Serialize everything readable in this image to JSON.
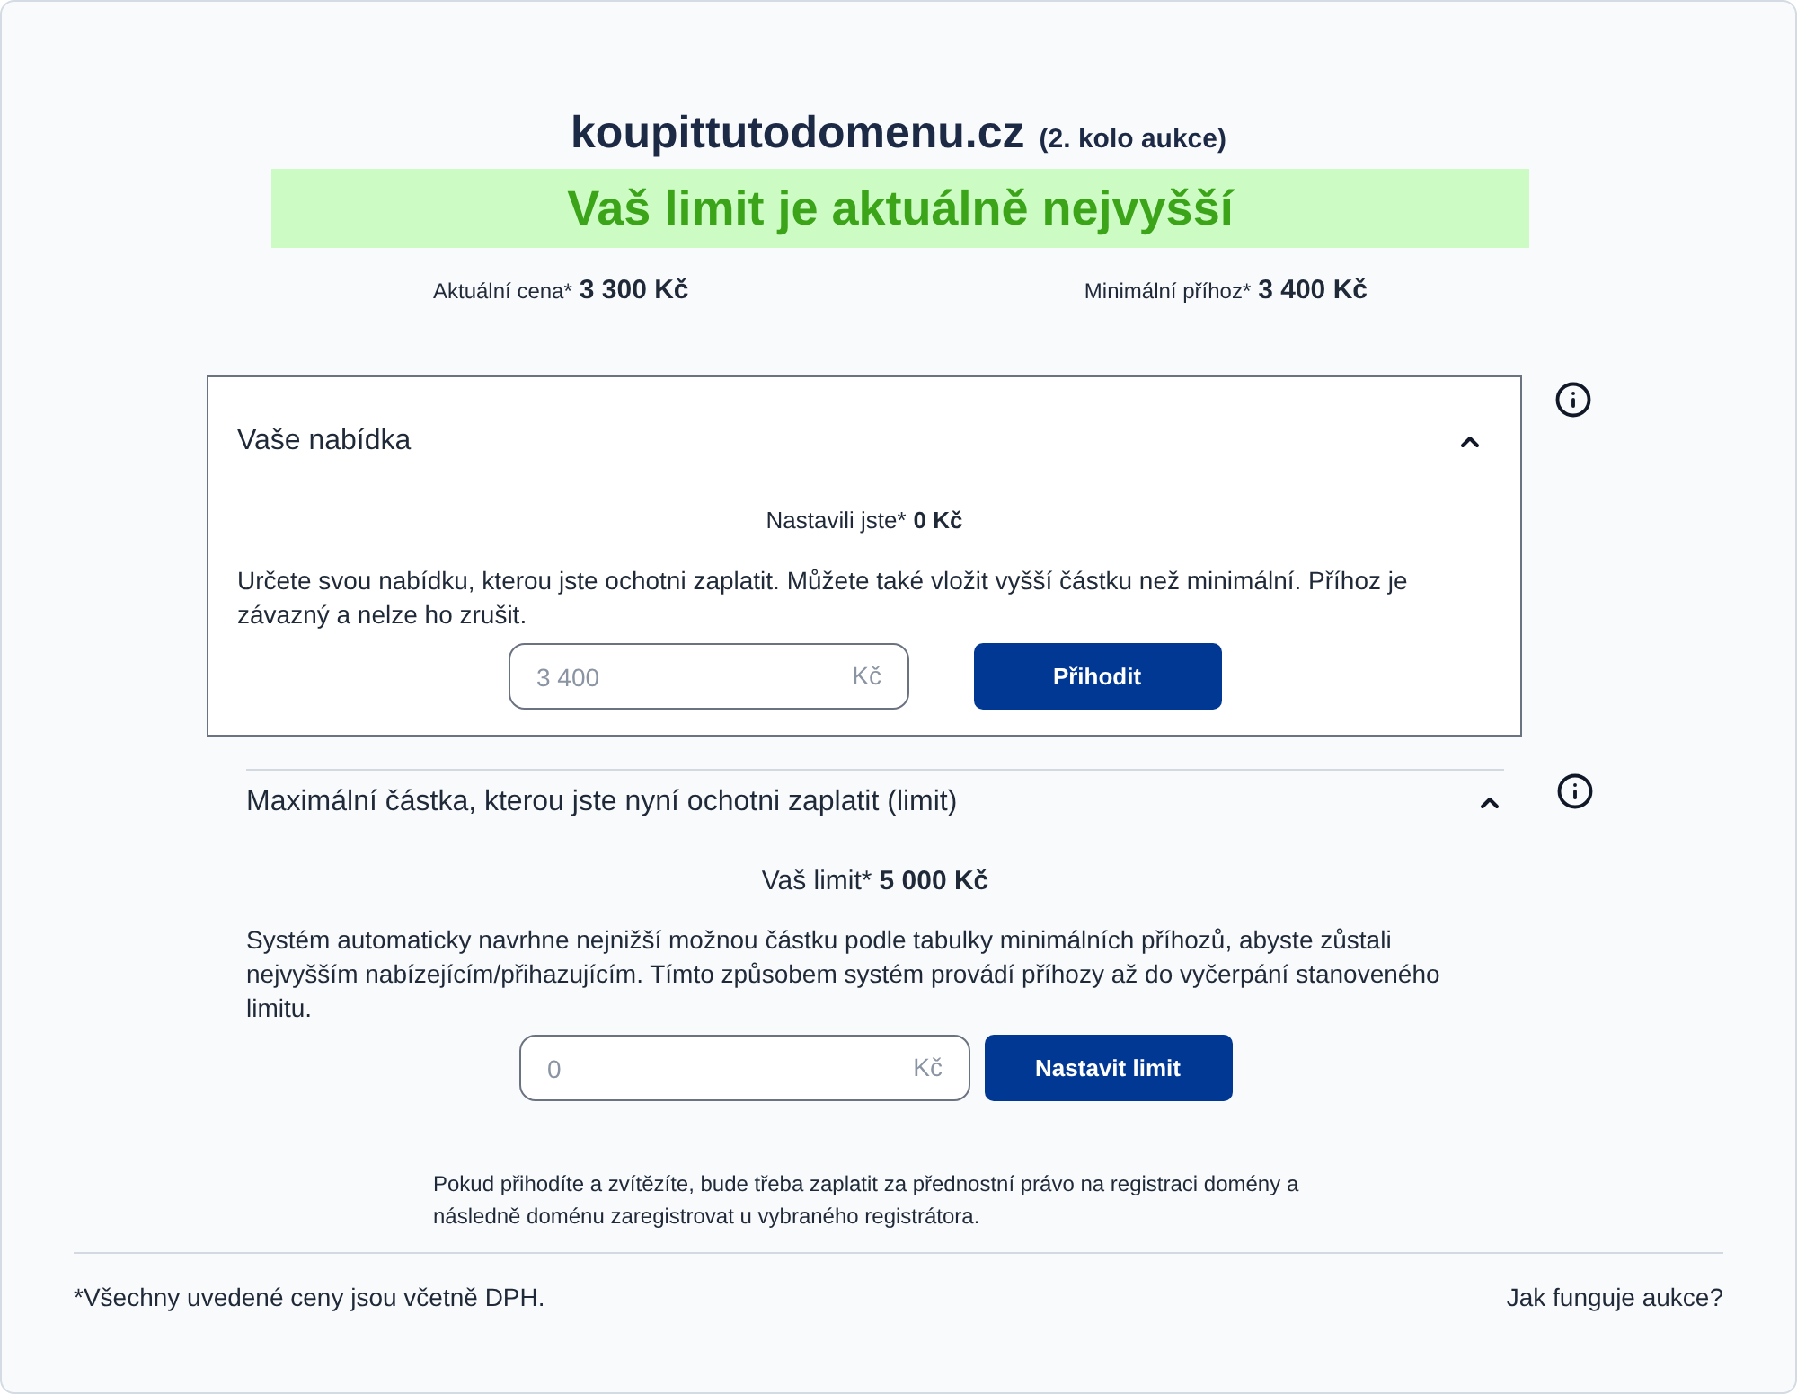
{
  "header": {
    "domain": "koupittutodomenu.cz",
    "round": "(2. kolo aukce)"
  },
  "status_banner": {
    "text": "Vaš limit je aktuálně nejvyšší"
  },
  "prices": [
    {
      "label": "Aktuální cena*",
      "value": "3 300 Kč"
    },
    {
      "label": "Minimální příhoz*",
      "value": "3 400 Kč"
    }
  ],
  "sections": [
    {
      "title": "Vaše nabídka",
      "expanded": true,
      "highlighted": true,
      "summary_label": "Nastavili jste*",
      "summary_value": "0 Kč",
      "description": "Určete svou nabídku, kterou jste ochotni zaplatit. Můžete také vložit vyšší částku než minimální. Příhoz je závazný a nelze ho zrušit.",
      "input": {
        "placeholder": "3 400",
        "suffix": "Kč"
      },
      "button": "Přihodit"
    },
    {
      "title": "Maximální částka, kterou jste nyní ochotni zaplatit (limit)",
      "expanded": true,
      "highlighted": false,
      "summary_label": "Vaš limit*",
      "summary_value": "5 000 Kč",
      "description": "Systém automaticky navrhne nejnižší možnou částku podle tabulky minimálních příhozů, abyste zůstali nejvyšším nabízejícím/přihazujícím. Tímto způsobem systém provádí příhozy až do vyčerpání stanoveného limitu.",
      "input": {
        "placeholder": "0",
        "suffix": "Kč"
      },
      "button": "Nastavit limit"
    }
  ],
  "note": "Pokud přihodíte a zvítězíte, bude třeba zaplatit za přednostní právo na registraci domény a následně doménu zaregistrovat u vybraného registrátora.",
  "footer": {
    "disclaimer": "*Všechny uvedené ceny jsou včetně DPH.",
    "link": "Jak funguje aukce?"
  }
}
